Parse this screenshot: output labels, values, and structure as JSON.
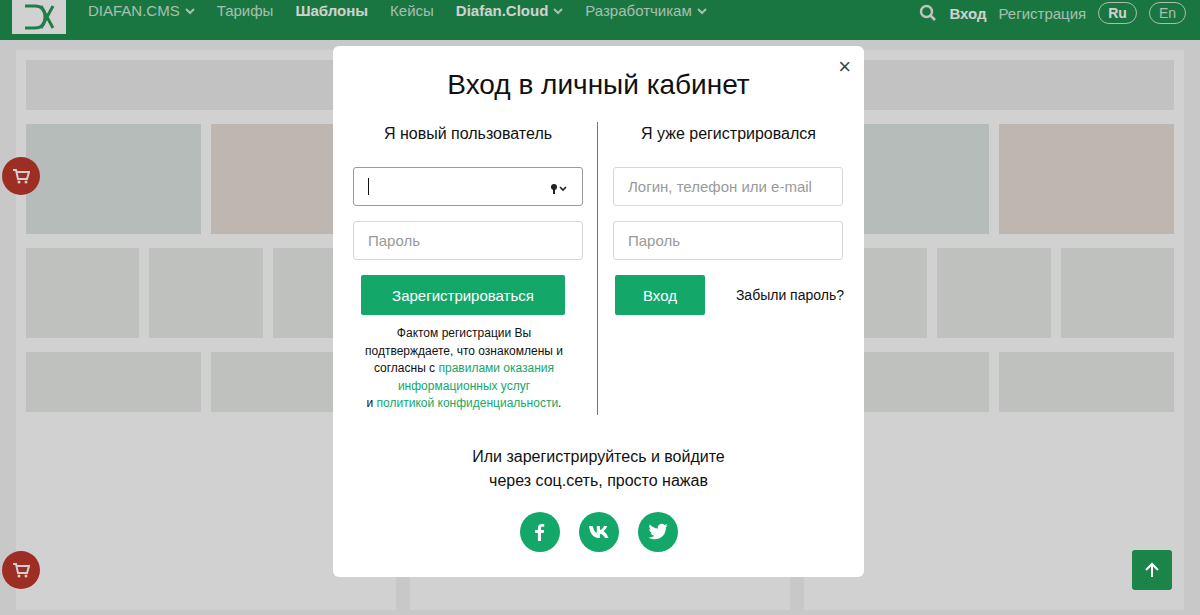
{
  "nav": {
    "items": [
      {
        "label": "DIAFAN.CMS",
        "dropdown": true,
        "bold": false
      },
      {
        "label": "Тарифы",
        "dropdown": false,
        "bold": false
      },
      {
        "label": "Шаблоны",
        "dropdown": false,
        "bold": true
      },
      {
        "label": "Кейсы",
        "dropdown": false,
        "bold": false
      },
      {
        "label": "Diafan.Cloud",
        "dropdown": true,
        "bold": true
      },
      {
        "label": "Разработчикам",
        "dropdown": true,
        "bold": false
      }
    ],
    "login": "Вход",
    "register": "Регистрация",
    "languages": [
      {
        "label": "Ru",
        "selected": true
      },
      {
        "label": "En",
        "selected": false
      }
    ]
  },
  "modal": {
    "title": "Вход в личный кабинет",
    "close": "×",
    "new_user": {
      "heading": "Я новый пользователь",
      "fields": [
        {
          "placeholder": "",
          "focused": true,
          "autofill": true
        },
        {
          "placeholder": "Пароль",
          "focused": false,
          "autofill": false
        }
      ],
      "button": "Зарегистрироваться",
      "terms": {
        "text": "Фактом регистрации Вы подтверждаете, что ознакомлены и согласны с",
        "link1": "правилами оказания информационных услуг",
        "and": "и",
        "link2": "политикой конфиденциальности",
        "end": "."
      }
    },
    "existing_user": {
      "heading": "Я уже регистрировался",
      "fields": [
        {
          "placeholder": "Логин, телефон или e-mail",
          "focused": false,
          "autofill": false
        },
        {
          "placeholder": "Пароль",
          "focused": false,
          "autofill": false
        }
      ],
      "button": "Вход",
      "forgot": "Забыли пароль?"
    },
    "social": {
      "lines": [
        "Или зарегистрируйтесь и войдите",
        "через соц.сеть, просто нажав"
      ],
      "buttons": [
        {
          "kind": "facebook"
        },
        {
          "kind": "vk"
        },
        {
          "kind": "twitter"
        }
      ]
    }
  }
}
